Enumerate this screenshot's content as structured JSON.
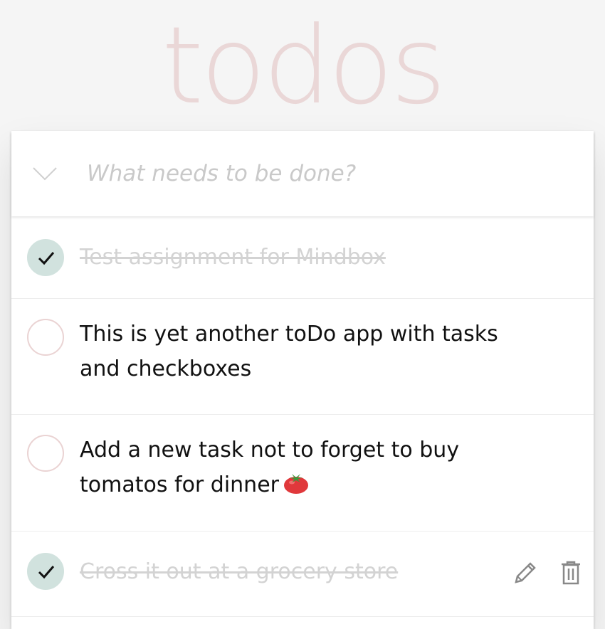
{
  "app": {
    "title": "todos"
  },
  "new_todo": {
    "placeholder": "What needs to be done?",
    "value": ""
  },
  "todos": [
    {
      "text": "Test assignment for Mindbox",
      "completed": true
    },
    {
      "text": "This is yet another toDo app with tasks and checkboxes",
      "completed": false
    },
    {
      "text": "Add a new task not to forget to buy tomatos for dinner",
      "completed": false,
      "emoji_icon": "tomato-icon"
    },
    {
      "text": "Cross it out at a grocery store",
      "completed": true,
      "actions": [
        "pencil-icon",
        "trash-icon"
      ]
    }
  ],
  "colors": {
    "title": "#ead7d7",
    "checkbox_done": "#d1e2de",
    "checkbox_border": "#ead3d3",
    "completed_text": "#d3d3d3",
    "text": "#111111",
    "background": "#f5f5f5"
  }
}
